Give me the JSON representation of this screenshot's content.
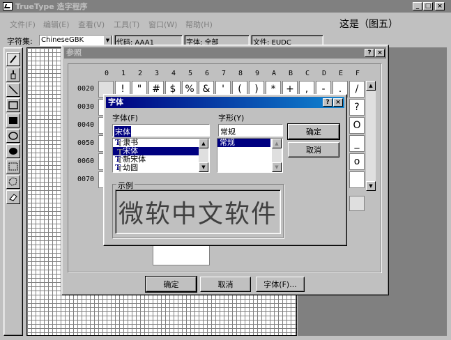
{
  "app": {
    "title": "TrueType 造字程序",
    "caption_right": "这是（图五）"
  },
  "menu": [
    "文件(F)",
    "编辑(E)",
    "查看(V)",
    "工具(T)",
    "窗口(W)",
    "帮助(H)"
  ],
  "infobar": {
    "charset_label": "字符集:",
    "charset_value": "ChineseGBK",
    "code": "代码: AAA1",
    "font": "字体: 全部",
    "file": "文件: EUDC"
  },
  "tools": [
    "pencil-icon",
    "brush-icon",
    "line-icon",
    "rectangle-outline-icon",
    "rectangle-filled-icon",
    "ellipse-outline-icon",
    "ellipse-filled-icon",
    "select-rect-icon",
    "select-freeform-icon",
    "eraser-icon"
  ],
  "reference_dialog": {
    "title": "参照",
    "col_headers": [
      "0",
      "1",
      "2",
      "3",
      "4",
      "5",
      "6",
      "7",
      "8",
      "9",
      "A",
      "B",
      "C",
      "D",
      "E",
      "F"
    ],
    "row_headers": [
      "0020",
      "0030",
      "0040",
      "0050",
      "0060",
      "0070"
    ],
    "row0020": [
      "",
      "!",
      "\"",
      "#",
      "$",
      "%",
      "&",
      "'",
      "(",
      ")",
      "*",
      "+",
      ",",
      "-",
      ".",
      "/"
    ],
    "col_f_visible": [
      "/",
      "?",
      "O",
      "_",
      "o",
      ""
    ],
    "ok": "确定",
    "cancel": "取消",
    "font_button": "字体(F)..."
  },
  "font_dialog": {
    "title": "字体",
    "font_label": "字体(F)",
    "font_value": "宋体",
    "fonts": [
      "隶书",
      "宋体",
      "新宋体",
      "幼圆"
    ],
    "selected_font": "宋体",
    "style_label": "字形(Y)",
    "style_value": "常规",
    "styles": [
      "常规"
    ],
    "ok": "确定",
    "cancel": "取消",
    "sample_label": "示例",
    "sample_text": "微软中文软件"
  }
}
